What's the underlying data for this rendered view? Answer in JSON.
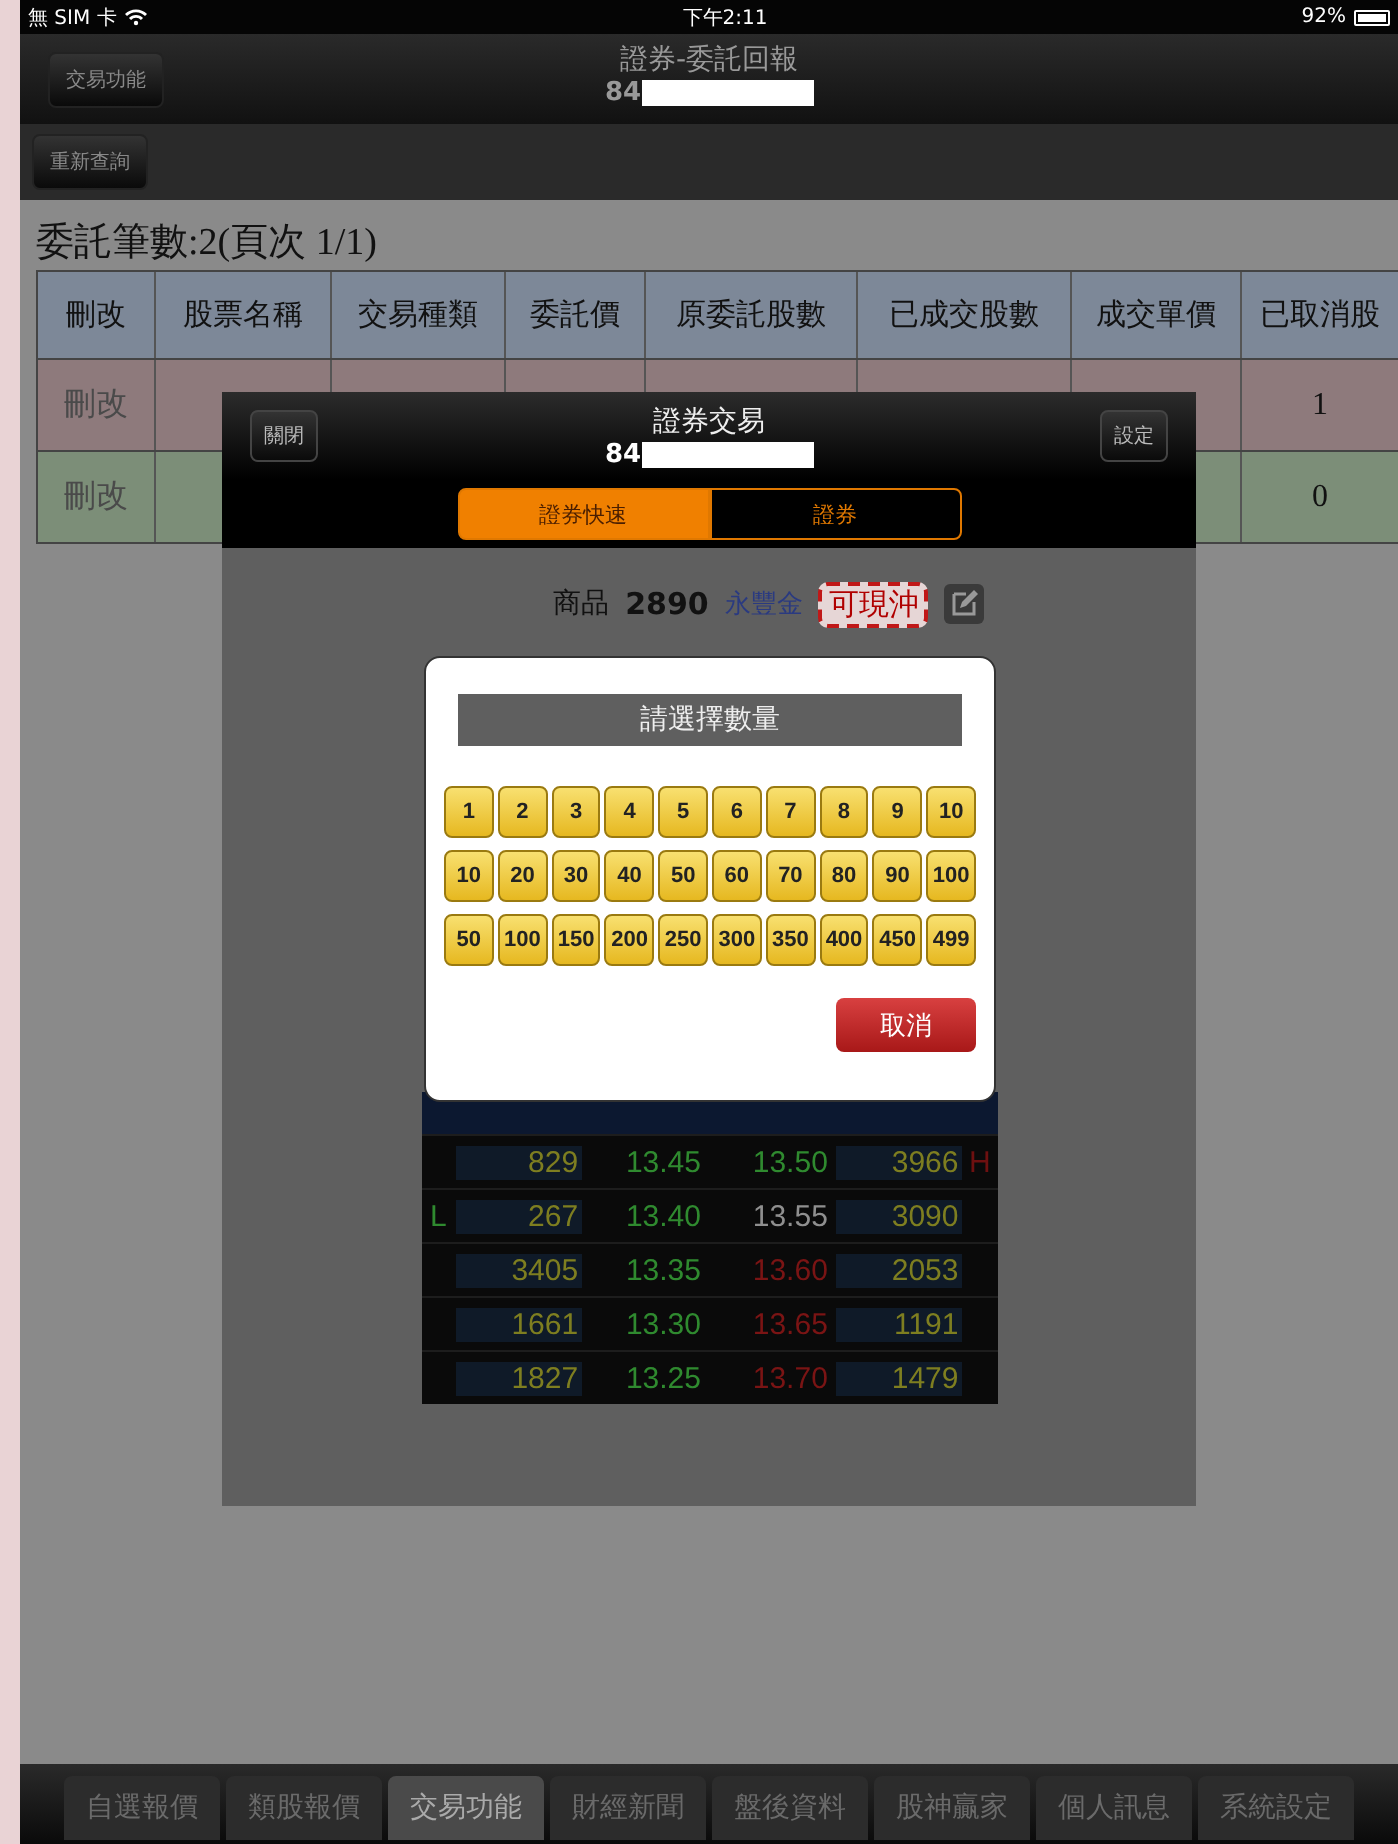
{
  "status_bar": {
    "carrier": "無 SIM 卡",
    "time": "下午2:11",
    "battery": "92%"
  },
  "nav_bar": {
    "left_button": "交易功能",
    "title": "證券-委託回報",
    "account": "84"
  },
  "toolbar": {
    "button": "重新查詢"
  },
  "orders": {
    "summary": "委託筆數:2(頁次 1/1)",
    "columns": [
      "刪改",
      "股票名稱",
      "交易種類",
      "委託價",
      "原委託股數",
      "已成交股數",
      "成交單價",
      "已取消股"
    ],
    "rows": [
      {
        "kind": "sell",
        "action": "刪改",
        "cancelled": "1"
      },
      {
        "kind": "buy",
        "action": "刪改",
        "cancelled": "0"
      }
    ]
  },
  "trade_window": {
    "close_button": "關閉",
    "title": "證券交易",
    "account": "84",
    "settings_button": "設定",
    "tabs": [
      {
        "label": "證券快速",
        "selected": true
      },
      {
        "label": "證券",
        "selected": false
      }
    ],
    "product": {
      "label": "商品",
      "code": "2890",
      "name": "永豐金",
      "tag": "可現沖"
    },
    "order_book": [
      {
        "bid_qty": "829",
        "bid": {
          "price": "13.45",
          "color": "#2f8a2f"
        },
        "ask": {
          "price": "13.50",
          "color": "#2f8a2f"
        },
        "ask_qty": "3966",
        "marker_right": "H"
      },
      {
        "marker_left": "L",
        "bid_qty": "267",
        "bid": {
          "price": "13.40",
          "color": "#2f8a2f"
        },
        "ask": {
          "price": "13.55",
          "color": "#8f8f8f"
        },
        "ask_qty": "3090"
      },
      {
        "bid_qty": "3405",
        "bid": {
          "price": "13.35",
          "color": "#2f8a2f"
        },
        "ask": {
          "price": "13.60",
          "color": "#7a1414"
        },
        "ask_qty": "2053"
      },
      {
        "bid_qty": "1661",
        "bid": {
          "price": "13.30",
          "color": "#2f8a2f"
        },
        "ask": {
          "price": "13.65",
          "color": "#7a1414"
        },
        "ask_qty": "1191"
      },
      {
        "bid_qty": "1827",
        "bid": {
          "price": "13.25",
          "color": "#2f8a2f"
        },
        "ask": {
          "price": "13.70",
          "color": "#7a1414"
        },
        "ask_qty": "1479"
      }
    ]
  },
  "quantity_dialog": {
    "title": "請選擇數量",
    "rows": [
      [
        "1",
        "2",
        "3",
        "4",
        "5",
        "6",
        "7",
        "8",
        "9",
        "10"
      ],
      [
        "10",
        "20",
        "30",
        "40",
        "50",
        "60",
        "70",
        "80",
        "90",
        "100"
      ],
      [
        "50",
        "100",
        "150",
        "200",
        "250",
        "300",
        "350",
        "400",
        "450",
        "499"
      ]
    ],
    "cancel_button": "取消"
  },
  "tab_bar": [
    {
      "label": "自選報價",
      "selected": false
    },
    {
      "label": "類股報價",
      "selected": false
    },
    {
      "label": "交易功能",
      "selected": true
    },
    {
      "label": "財經新聞",
      "selected": false
    },
    {
      "label": "盤後資料",
      "selected": false
    },
    {
      "label": "股神贏家",
      "selected": false
    },
    {
      "label": "個人訊息",
      "selected": false
    },
    {
      "label": "系統設定",
      "selected": false
    }
  ]
}
